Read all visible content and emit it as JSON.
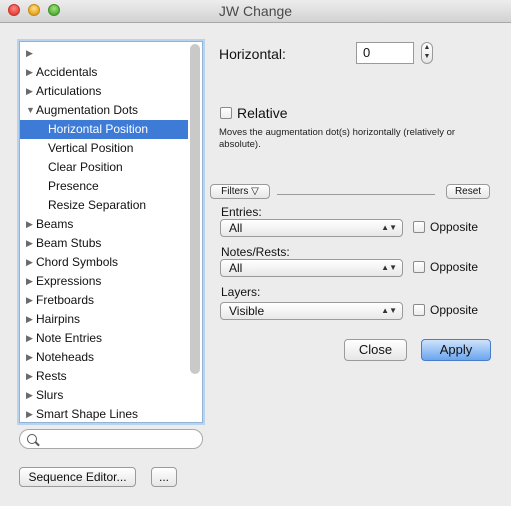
{
  "window": {
    "title": "JW Change"
  },
  "tree": {
    "items": [
      {
        "label": "",
        "expanded": false,
        "child": false
      },
      {
        "label": "Accidentals",
        "expanded": false,
        "child": false
      },
      {
        "label": "Articulations",
        "expanded": false,
        "child": false
      },
      {
        "label": "Augmentation Dots",
        "expanded": true,
        "child": false
      },
      {
        "label": "Horizontal Position",
        "child": true,
        "selected": true
      },
      {
        "label": "Vertical Position",
        "child": true
      },
      {
        "label": "Clear Position",
        "child": true
      },
      {
        "label": "Presence",
        "child": true
      },
      {
        "label": "Resize Separation",
        "child": true
      },
      {
        "label": "Beams",
        "expanded": false,
        "child": false
      },
      {
        "label": "Beam Stubs",
        "expanded": false,
        "child": false
      },
      {
        "label": "Chord Symbols",
        "expanded": false,
        "child": false
      },
      {
        "label": "Expressions",
        "expanded": false,
        "child": false
      },
      {
        "label": "Fretboards",
        "expanded": false,
        "child": false
      },
      {
        "label": "Hairpins",
        "expanded": false,
        "child": false
      },
      {
        "label": "Note Entries",
        "expanded": false,
        "child": false
      },
      {
        "label": "Noteheads",
        "expanded": false,
        "child": false
      },
      {
        "label": "Rests",
        "expanded": false,
        "child": false
      },
      {
        "label": "Slurs",
        "expanded": false,
        "child": false
      },
      {
        "label": "Smart Shape Lines",
        "expanded": false,
        "child": false
      }
    ]
  },
  "search": {
    "value": ""
  },
  "bottom": {
    "sequence_editor": "Sequence Editor...",
    "more": "..."
  },
  "settings": {
    "horizontal_label": "Horizontal:",
    "horizontal_value": "0",
    "relative_label": "Relative",
    "description": "Moves the augmentation dot(s) horizontally (relatively or absolute)."
  },
  "filters": {
    "filters_button": "Filters ▽",
    "reset_button": "Reset",
    "entries_label": "Entries:",
    "entries_value": "All",
    "notes_label": "Notes/Rests:",
    "notes_value": "All",
    "layers_label": "Layers:",
    "layers_value": "Visible",
    "opposite_label": "Opposite"
  },
  "actions": {
    "close": "Close",
    "apply": "Apply"
  },
  "colors": {
    "selection": "#3d7bd6",
    "apply": "#6aa5ef"
  }
}
